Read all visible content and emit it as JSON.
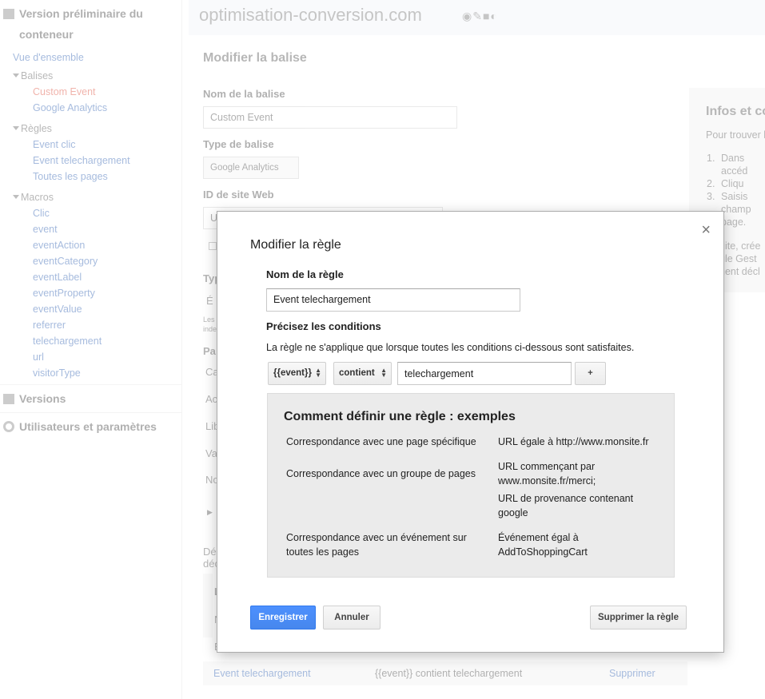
{
  "sidebar": {
    "container_label": "Version préliminaire du conteneur",
    "overview": "Vue d'ensemble",
    "balises": {
      "label": "Balises",
      "items": [
        "Custom Event",
        "Google Analytics"
      ]
    },
    "regles": {
      "label": "Règles",
      "items": [
        "Event clic",
        "Event telechargement",
        "Toutes les pages"
      ]
    },
    "macros": {
      "label": "Macros",
      "items": [
        "Clic",
        "event",
        "eventAction",
        "eventCategory",
        "eventLabel",
        "eventProperty",
        "eventValue",
        "referrer",
        "telechargement",
        "url",
        "visitorType"
      ]
    },
    "versions": "Versions",
    "users_settings": "Utilisateurs et paramètres"
  },
  "header": {
    "site": "optimisation-conversion.com"
  },
  "page": {
    "title": "Modifier la balise",
    "tag_name_label": "Nom de la balise",
    "tag_name_value": "Custom Event",
    "tag_type_label": "Type de balise",
    "tag_type_value": "Google Analytics",
    "site_id_label": "ID de site Web",
    "site_id_fragment": "U",
    "frag_typ": "Typ",
    "frag_e": "É",
    "frag_les": "Les",
    "frag_inde": "inde",
    "frag_pa": "Pa",
    "frag_ca": "Ca",
    "frag_ac": "Ac",
    "frag_lib": "Lib",
    "frag_va": "Va",
    "frag_no": "No",
    "frag_de1": "Dé",
    "frag_de2": "déc",
    "frag_l": "L",
    "frag_n": "N",
    "frag_e2": "É"
  },
  "infobox": {
    "title": "Infos et co",
    "intro": "Pour trouver l",
    "steps": [
      "Dans",
      "accéd",
      "Cliqu",
      "Saisis",
      "champ",
      "page."
    ],
    "step_numbers": [
      "1.",
      "2.",
      "3."
    ],
    "tail": [
      "uite, crée",
      "gle Gest",
      "nent décl"
    ]
  },
  "rules_table": {
    "row": {
      "name": "Event telechargement",
      "condition": "{{event}} contient telechargement",
      "action": "Supprimer"
    }
  },
  "modal": {
    "title": "Modifier la règle",
    "close": "×",
    "rule_name_label": "Nom de la règle",
    "rule_name_value": "Event telechargement",
    "conditions_label": "Précisez les conditions",
    "conditions_desc": "La règle ne s'applique que lorsque toutes les conditions ci-dessous sont satisfaites.",
    "condition": {
      "variable": "{{event}}",
      "operator": "contient",
      "value": "telechargement",
      "add": "+"
    },
    "examples": {
      "title": "Comment définir une règle : exemples",
      "rows": [
        {
          "case": "Correspondance avec une page spécifique",
          "rule": "URL égale à http://www.monsite.fr"
        },
        {
          "case": "Correspondance avec un groupe de pages",
          "rule": "URL commençant par www.monsite.fr/merci;",
          "rule2": "URL de provenance contenant google"
        },
        {
          "case": "Correspondance avec un événement sur toutes les pages",
          "rule": "Événement égal à AddToShoppingCart"
        }
      ]
    },
    "buttons": {
      "save": "Enregistrer",
      "cancel": "Annuler",
      "delete": "Supprimer la règle"
    }
  }
}
